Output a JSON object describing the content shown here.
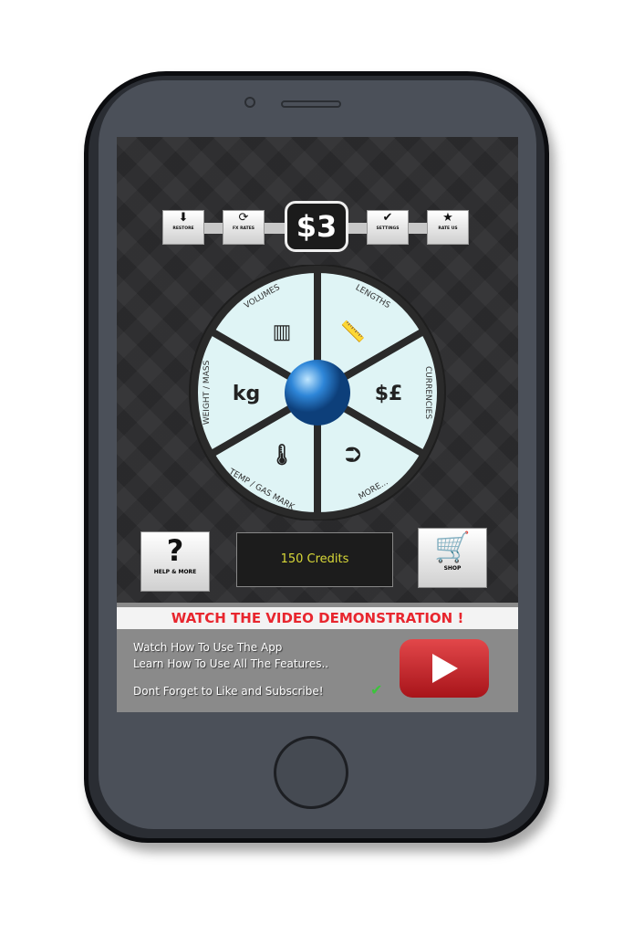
{
  "toolbar": {
    "restore": "RESTORE",
    "fx_rates": "FX RATES",
    "settings": "SETTINGS",
    "rate_us": "RATE US"
  },
  "wheel": {
    "segments": [
      {
        "label": "LENGTHS",
        "icon": "ruler-icon",
        "glyph": "📏"
      },
      {
        "label": "CURRENCIES",
        "icon": "currency-icon",
        "glyph": "$£"
      },
      {
        "label": "MORE...",
        "icon": "arrow-circle-icon",
        "glyph": "⮊"
      },
      {
        "label": "TEMP / GAS MARK",
        "icon": "thermometer-icon",
        "glyph": "🌡"
      },
      {
        "label": "WEIGHT / MASS",
        "icon": "kg-weight-icon",
        "glyph": "kg"
      },
      {
        "label": "VOLUMES",
        "icon": "beaker-icon",
        "glyph": "▥"
      }
    ],
    "segment_color": "#dff4f5",
    "hub_color": "#2e86d8"
  },
  "help_label": "HELP & MORE",
  "shop_label": "SHOP",
  "credits": "150 Credits",
  "promo": {
    "title": "WATCH THE VIDEO DEMONSTRATION !",
    "line1": "Watch How To Use The App",
    "line2": "Learn How To Use All The Features..",
    "line3": "Dont Forget to Like and Subscribe!"
  }
}
